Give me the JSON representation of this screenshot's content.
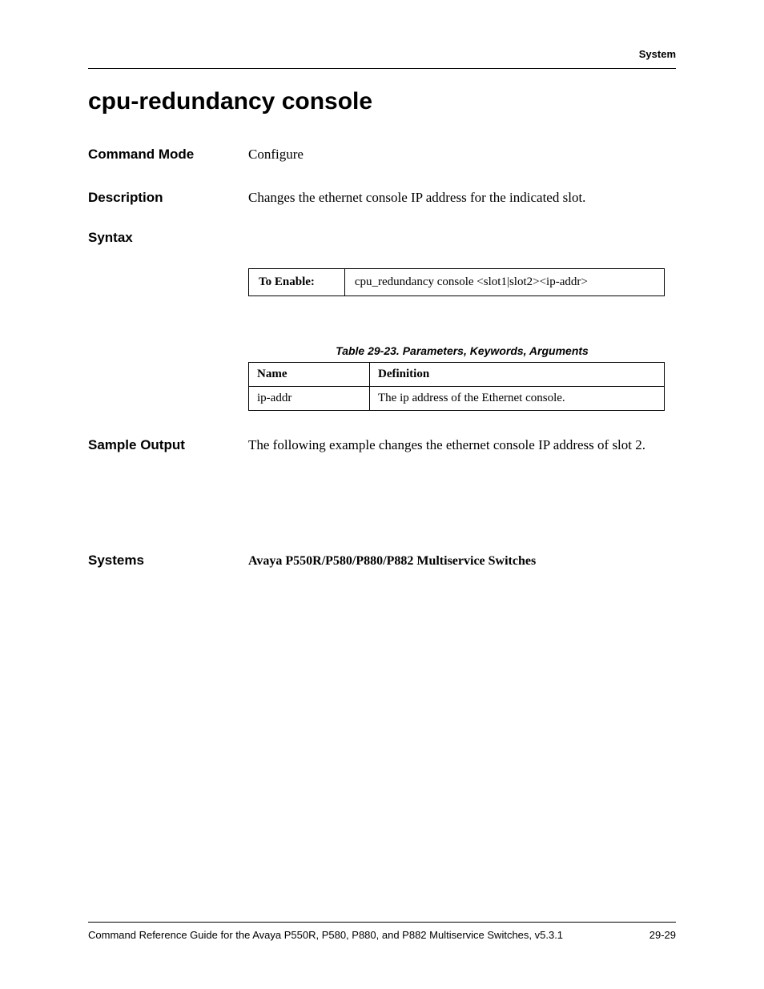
{
  "header": {
    "section": "System"
  },
  "title": "cpu-redundancy console",
  "sections": {
    "command_mode": {
      "label": "Command Mode",
      "value": "Configure"
    },
    "description": {
      "label": "Description",
      "value": "Changes the ethernet console IP address for the indicated slot."
    },
    "syntax": {
      "label": "Syntax",
      "to_enable_label": "To Enable:",
      "to_enable_value": "cpu_redundancy console <slot1|slot2><ip-addr>"
    },
    "params_table": {
      "caption": "Table 29-23.  Parameters, Keywords, Arguments",
      "headers": [
        "Name",
        "Definition"
      ],
      "rows": [
        {
          "name": "ip-addr",
          "definition": "The ip address of the Ethernet console."
        }
      ]
    },
    "sample_output": {
      "label": "Sample Output",
      "value": "The following example changes the ethernet console IP address of slot 2."
    },
    "systems": {
      "label": "Systems",
      "value": "Avaya P550R/P580/P880/P882 Multiservice Switches"
    }
  },
  "footer": {
    "left": "Command Reference Guide for the Avaya P550R, P580, P880, and P882 Multiservice Switches, v5.3.1",
    "right": "29-29"
  }
}
